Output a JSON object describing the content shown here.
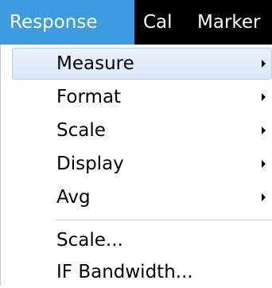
{
  "menubar": {
    "items": [
      {
        "label": "Response",
        "active": true
      },
      {
        "label": "Cal",
        "active": false
      },
      {
        "label": "Marker",
        "active": false
      }
    ]
  },
  "menu": {
    "items": [
      {
        "label": "Measure",
        "submenu": true,
        "highlighted": true
      },
      {
        "label": "Format",
        "submenu": true
      },
      {
        "label": "Scale",
        "submenu": true
      },
      {
        "label": "Display",
        "submenu": true
      },
      {
        "label": "Avg",
        "submenu": true
      },
      {
        "label": "Scale...",
        "submenu": false
      },
      {
        "label": "IF Bandwidth...",
        "submenu": false
      }
    ]
  },
  "colors": {
    "menubar_bg": "#000000",
    "active_menu_bg": "#3d9ce0",
    "highlight_bg": "#dbe8f9"
  }
}
